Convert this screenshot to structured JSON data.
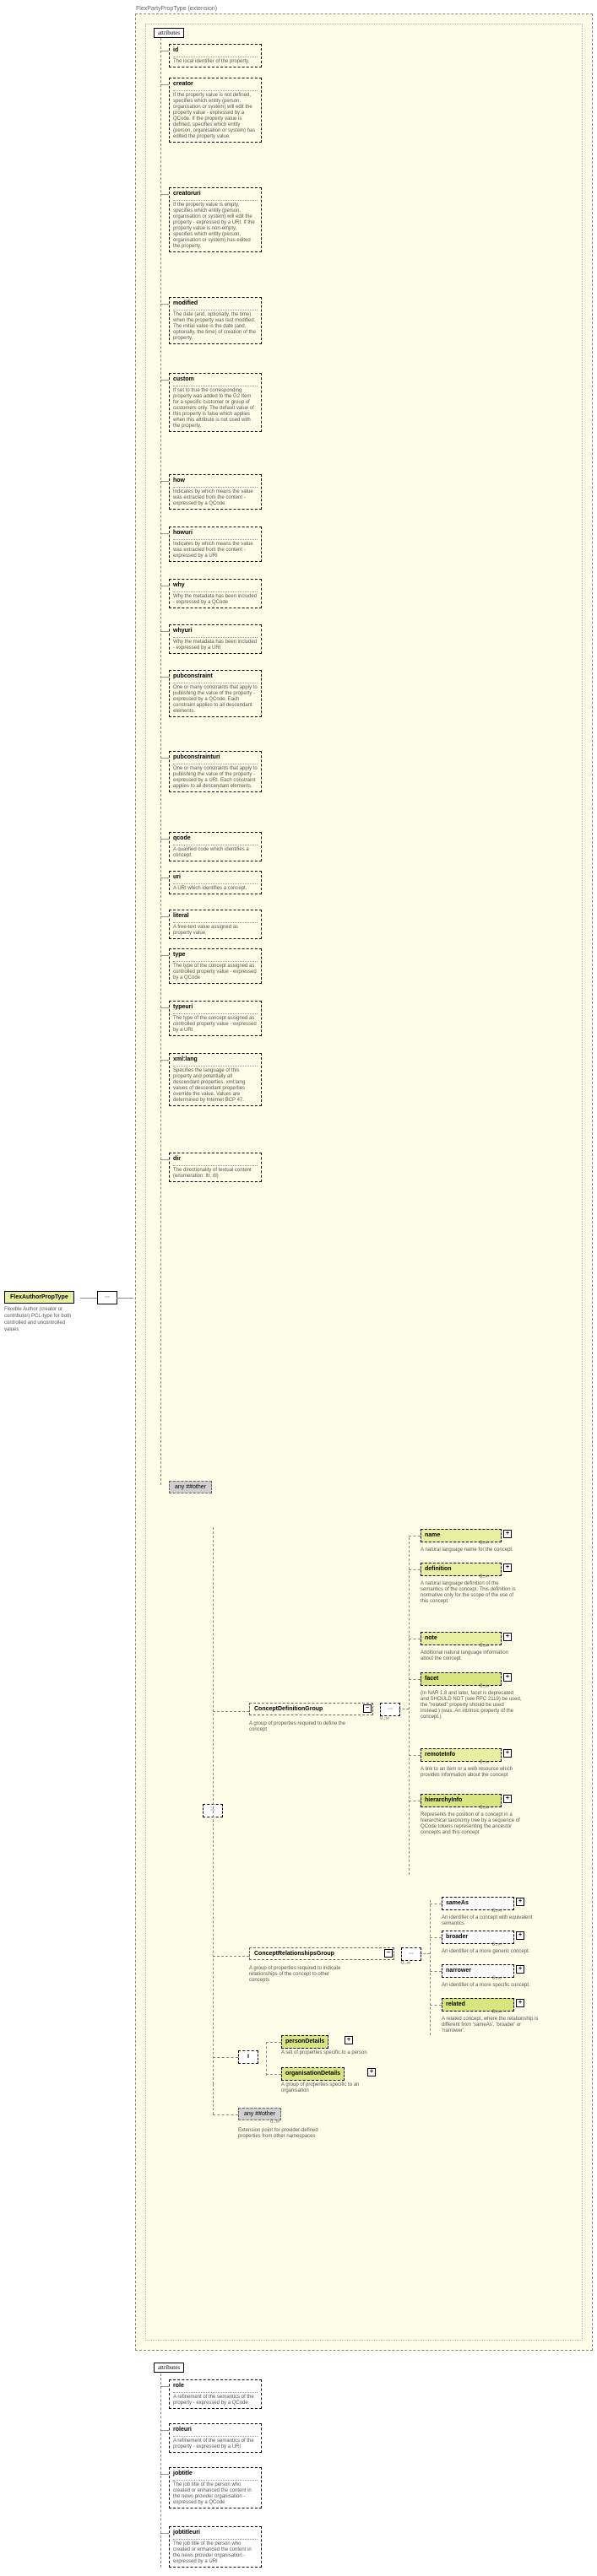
{
  "root": {
    "name": "FlexAuthorPropType",
    "doc": "Flexible Author (creator or contributor) PCL-type for both controlled and uncontrolled values"
  },
  "extension": {
    "label": "FlexPartyPropType (extension)"
  },
  "attr_header": "attributes",
  "attrs": [
    {
      "name": "id",
      "doc": "The local identifier of the property."
    },
    {
      "name": "creator",
      "doc": "If the property value is not defined, specifies which entity (person, organisation or system) will edit the property value - expressed by a QCode. If the property value is defined, specifies which entity (person, organisation or system) has edited the property value."
    },
    {
      "name": "creatoruri",
      "doc": "If the property value is empty, specifies which entity (person, organisation or system) will edit the property - expressed by a URI. If the property value is non-empty, specifies which entity (person, organisation or system) has edited the property."
    },
    {
      "name": "modified",
      "doc": "The date (and, optionally, the time) when the property was last modified. The initial value is the date (and, optionally, the time) of creation of the property."
    },
    {
      "name": "custom",
      "doc": "If set to true the corresponding property was added to the G2 Item for a specific customer or group of customers only. The default value of this property is false which applies when this attribute is not used with the property."
    },
    {
      "name": "how",
      "doc": "Indicates by which means the value was extracted from the content - expressed by a QCode"
    },
    {
      "name": "howuri",
      "doc": "Indicates by which means the value was extracted from the content - expressed by a URI"
    },
    {
      "name": "why",
      "doc": "Why the metadata has been included - expressed by a QCode"
    },
    {
      "name": "whyuri",
      "doc": "Why the metadata has been included - expressed by a URI"
    },
    {
      "name": "pubconstraint",
      "doc": "One or many constraints that apply to publishing the value of the property - expressed by a QCode. Each constraint applies to all descendant elements."
    },
    {
      "name": "pubconstrainturi",
      "doc": "One or many constraints that apply to publishing the value of the property - expressed by a URI. Each constraint applies to all descendant elements."
    },
    {
      "name": "qcode",
      "doc": "A qualified code which identifies a concept."
    },
    {
      "name": "uri",
      "doc": "A URI which identifies a concept."
    },
    {
      "name": "literal",
      "doc": "A free-text value assigned as property value."
    },
    {
      "name": "type",
      "doc": "The type of the concept assigned as controlled property value - expressed by a QCode"
    },
    {
      "name": "typeuri",
      "doc": "The type of the concept assigned as controlled property value - expressed by a URI"
    },
    {
      "name": "xml:lang",
      "doc": "Specifies the language of this property and potentially all descendant properties. xml:lang values of descendant properties override the value. Values are determined by Internet BCP 47."
    },
    {
      "name": "dir",
      "doc": "The directionality of textual content (enumeration: ltr, rtl)"
    }
  ],
  "top_any": "any ##other",
  "conceptDefinitionGroup": {
    "name": "ConceptDefinitionGroup",
    "doc": "A group of properties required to define the concept"
  },
  "defGroup": [
    {
      "name": "name",
      "doc": "A natural language name for the concept."
    },
    {
      "name": "definition",
      "doc": "A natural language definition of the semantics of the concept. This definition is normative only for the scope of the use of this concept."
    },
    {
      "name": "note",
      "doc": "Additional natural language information about the concept."
    },
    {
      "name": "facet",
      "doc": "(In NAR 1.8 and later, facet is deprecated and SHOULD NOT (see RFC 2119) be used, the \"related\" property should be used instead.) (was: An intrinsic property of the concept.)"
    },
    {
      "name": "remoteInfo",
      "doc": "A link to an item or a web resource which provides information about the concept"
    },
    {
      "name": "hierarchyInfo",
      "doc": "Represents the position of a concept in a hierarchical taxonomy tree by a sequence of QCode tokens representing the ancestor concepts and this concept"
    }
  ],
  "conceptRelGroup": {
    "name": "ConceptRelationshipsGroup",
    "doc": "A group of properties required to indicate relationships of the concept to other concepts"
  },
  "relGroup": [
    {
      "name": "sameAs",
      "doc": "An identifier of a concept with equivalent semantics"
    },
    {
      "name": "broader",
      "doc": "An identifier of a more generic concept."
    },
    {
      "name": "narrower",
      "doc": "An identifier of a more specific concept."
    },
    {
      "name": "related",
      "doc": "A related concept, where the relationship is different from 'sameAs', 'broader' or 'narrower'."
    }
  ],
  "details": {
    "personDetails": {
      "name": "personDetails",
      "doc": "A set of properties specific to a person"
    },
    "organisationDetails": {
      "name": "organisationDetails",
      "doc": "A group of properties specific to an organisation"
    }
  },
  "ext_any": {
    "label": "any ##other",
    "doc": "Extension point for provider-defined properties from other namespaces",
    "card": "0..∞"
  },
  "bottom_attrs": [
    {
      "name": "role",
      "doc": "A refinement of the semantics of the property - expressed by a QCode"
    },
    {
      "name": "roleuri",
      "doc": "A refinement of the semantics of the property - expressed by a URI"
    },
    {
      "name": "jobtitle",
      "doc": "The job title of the person who created or enhanced the content in the news provider organisation - expressed by a QCode"
    },
    {
      "name": "jobtitleuri",
      "doc": "The job title of the person who created or enhanced the content in the news provider organisation - expressed by a URI"
    }
  ],
  "cardinality": {
    "zero_inf": "0..∞"
  }
}
